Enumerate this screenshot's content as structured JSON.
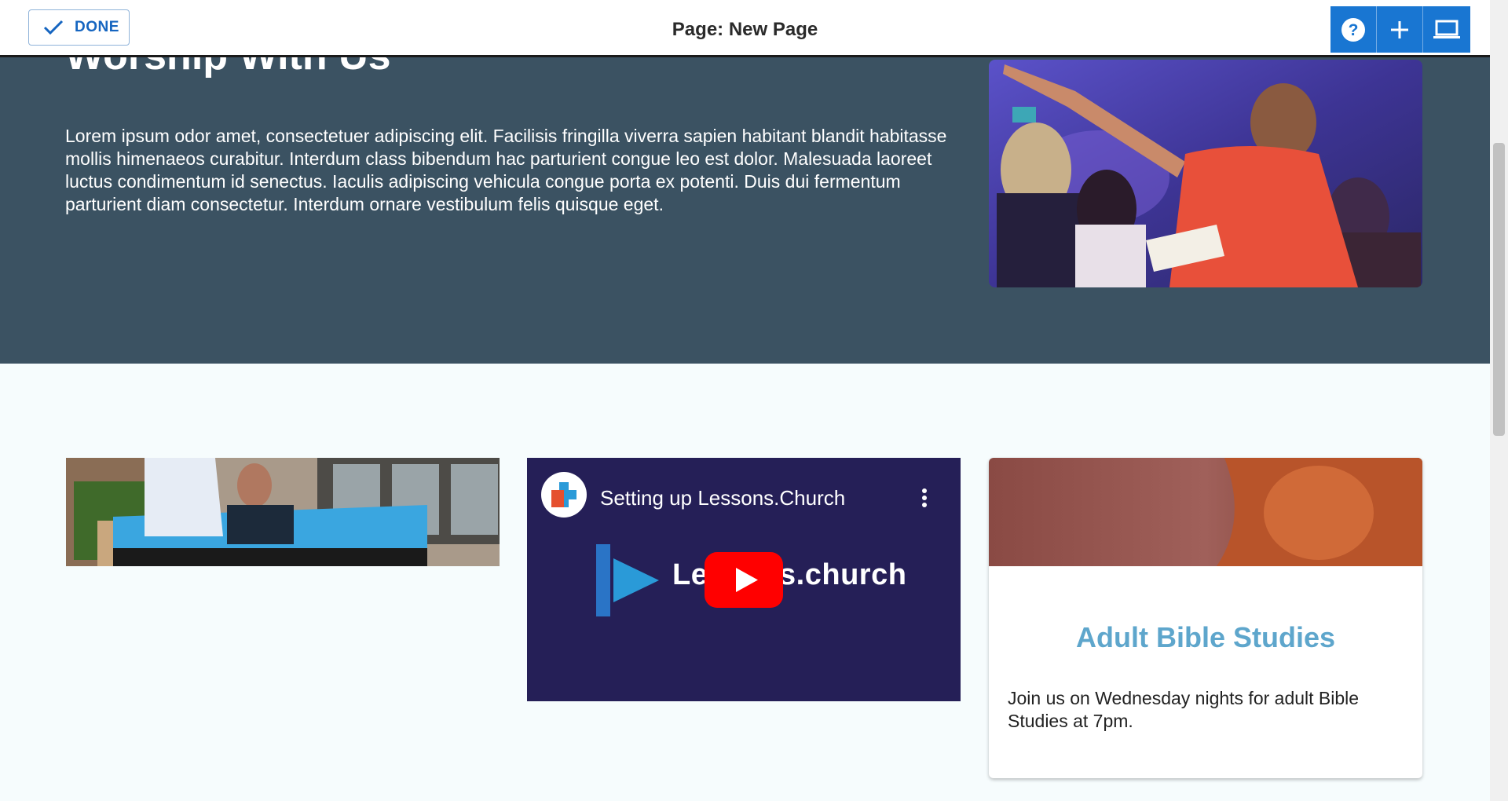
{
  "toolbar": {
    "done_label": "DONE",
    "page_title": "Page: New Page",
    "buttons": [
      {
        "icon": "help-icon"
      },
      {
        "icon": "plus-icon"
      },
      {
        "icon": "laptop-icon"
      }
    ],
    "accent_color": "#1976d2"
  },
  "hero": {
    "heading": "Worship With Us",
    "body": "Lorem ipsum odor amet, consectetuer adipiscing elit. Facilisis fringilla viverra sapien habitant blandit habitasse mollis himenaeos curabitur. Interdum class bibendum hac parturient congue leo est dolor. Malesuada laoreet luctus condimentum id senectus. Iaculis adipiscing vehicula congue porta ex potenti. Duis dui fermentum parturient diam consectetur. Interdum ornare vestibulum felis quisque eget.",
    "background_color": "#3b5262"
  },
  "video": {
    "title": "Setting up Lessons.Church",
    "brand_text": "Lessons.church",
    "background_color": "#251f57"
  },
  "card": {
    "title": "Adult Bible Studies",
    "body": "Join us on Wednesday nights for adult Bible Studies at 7pm.",
    "title_color": "#5ea6cc"
  }
}
